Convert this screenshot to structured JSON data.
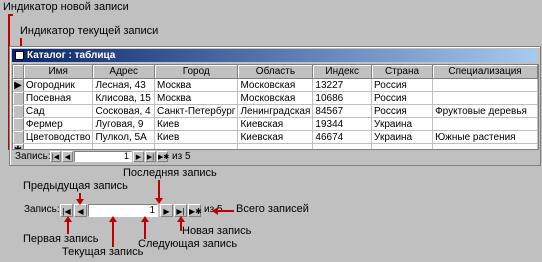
{
  "callouts": {
    "new_record_indicator": "Индикатор новой записи",
    "current_record_indicator": "Индикатор текущей записи",
    "prev_record": "Предыдущая запись",
    "last_record": "Последняя запись",
    "total_records": "Всего записей",
    "first_record": "Первая запись",
    "new_record": "Новая запись",
    "current_record": "Текущая запись",
    "next_record": "Следующая запись"
  },
  "window": {
    "title": "Каталог : таблица",
    "columns": [
      "Имя",
      "Адрес",
      "Город",
      "Область",
      "Индекс",
      "Страна",
      "Специализация"
    ],
    "rows": [
      {
        "selector": "▶",
        "cells": [
          "Огородник",
          "Лесная, 43",
          "Москва",
          "Московская",
          "13227",
          "Россия",
          ""
        ]
      },
      {
        "selector": "",
        "cells": [
          "Посевная",
          "Клисова, 15",
          "Москва",
          "Московская",
          "10686",
          "Россия",
          ""
        ]
      },
      {
        "selector": "",
        "cells": [
          "Сад",
          "Сосковая, 4",
          "Санкт-Петербург",
          "Ленинградская",
          "84567",
          "Россия",
          "Фруктовые деревья"
        ]
      },
      {
        "selector": "",
        "cells": [
          "Фермер",
          "Луговая, 9",
          "Киев",
          "Киевская",
          "19344",
          "Украина",
          ""
        ]
      },
      {
        "selector": "",
        "cells": [
          "Цветоводство",
          "Пулкол, 5А",
          "Киев",
          "Киевская",
          "46674",
          "Украина",
          "Южные растения"
        ]
      },
      {
        "selector": "✱",
        "cells": [
          "",
          "",
          "",
          "",
          "",
          "",
          ""
        ]
      }
    ]
  },
  "navigator": {
    "label": "Запись:",
    "first_icon": "first-record-icon",
    "prev_icon": "prev-record-icon",
    "current_value": "1",
    "next_icon": "next-record-icon",
    "last_icon": "last-record-icon",
    "new_icon": "new-record-icon",
    "of_text": "из 5"
  },
  "colors": {
    "accent": "#c00000",
    "title_start": "#0a246a",
    "title_end": "#a6caf0"
  }
}
